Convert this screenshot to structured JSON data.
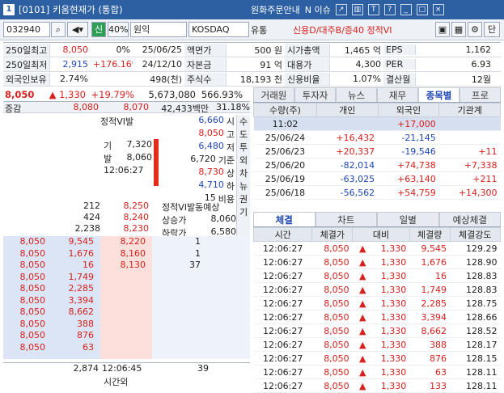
{
  "title": {
    "number": "1",
    "name": "[0101] 키움현재가 (통합)",
    "btn_order_guide": "원화주문안내",
    "btn_issue": "N 이슈"
  },
  "toolbar": {
    "code": "032940",
    "qty": "40%",
    "name": "원익",
    "market": "KOSDAQ",
    "sector": "유통",
    "status": "신용D/대주B/증40 정적VI",
    "btn_new": "신",
    "btn_search": "단"
  },
  "info": {
    "r1": [
      "250일최고",
      "8,050",
      "0%",
      "25/06/25",
      "액면가",
      "500 원",
      "시가총액",
      "1,465 억",
      "EPS",
      "1,162"
    ],
    "r2": [
      "250일최저",
      "2,915",
      "+176.16%",
      "24/12/10",
      "자본금",
      "91 억",
      "대용가",
      "4,300",
      "PER",
      "6.93"
    ],
    "r3": [
      "외국인보유",
      "2.74%",
      "498(천)",
      "주식수",
      "18,193 천",
      "신용비율",
      "1.07%",
      "결산월",
      "12월"
    ]
  },
  "price": {
    "cur": "8,050",
    "change": "▲ 1,330",
    "rate": "+19.79%",
    "volume": "5,673,080",
    "vol_rate": "566.93%"
  },
  "orderbook": {
    "head": [
      "증감",
      "8,080",
      "8,070",
      "42,433백만",
      "31.18%"
    ],
    "vi_label": "정적VI발",
    "summary": [
      [
        "기",
        "7,320"
      ],
      [
        "발",
        "8,060"
      ],
      [
        "12:06:27",
        ""
      ]
    ],
    "sidestat": [
      [
        "6,660",
        "시"
      ],
      [
        "8,050",
        "고"
      ],
      [
        "6,480",
        "저"
      ],
      [
        "6,720",
        "기준"
      ],
      [
        "8,730",
        "상"
      ],
      [
        "4,710",
        "하"
      ],
      [
        "15",
        "비용"
      ]
    ],
    "side_tabs": [
      "수",
      "도",
      "투",
      "외",
      "차",
      "뉴",
      "권",
      "기"
    ],
    "ask": [
      [
        "212",
        "8,250"
      ],
      [
        "424",
        "8,240"
      ],
      [
        "2,238",
        "8,230"
      ]
    ],
    "expect": {
      "label": "정적VI발동예상",
      "up_label": "상승가",
      "up": "8,060",
      "down_label": "하락가",
      "down": "6,580"
    },
    "bid": [
      [
        "8,050",
        "9,545",
        "8,220",
        "1"
      ],
      [
        "8,050",
        "1,676",
        "8,160",
        "1"
      ],
      [
        "8,050",
        "16",
        "8,130",
        "37"
      ],
      [
        "8,050",
        "1,749",
        "",
        ""
      ],
      [
        "8,050",
        "2,285",
        "",
        ""
      ],
      [
        "8,050",
        "3,394",
        "",
        ""
      ],
      [
        "8,050",
        "8,662",
        "",
        ""
      ],
      [
        "8,050",
        "388",
        "",
        ""
      ],
      [
        "8,050",
        "876",
        "",
        ""
      ],
      [
        "8,050",
        "63",
        "",
        ""
      ]
    ],
    "footer": [
      "2,874",
      "12:06:45",
      "39"
    ],
    "after": "시간외"
  },
  "right": {
    "tabs1": [
      "거래원",
      "투자자",
      "뉴스",
      "재무",
      "종목별",
      "프로"
    ],
    "inv_head": [
      "수량(주)",
      "개인",
      "외국인",
      "기관계"
    ],
    "inv_rows": [
      [
        "11:02",
        "",
        "+17,000",
        ""
      ],
      [
        "25/06/24",
        "+16,432",
        "-21,145",
        ""
      ],
      [
        "25/06/23",
        "+20,337",
        "-19,546",
        "+11"
      ],
      [
        "25/06/20",
        "-82,014",
        "+74,738",
        "+7,338"
      ],
      [
        "25/06/19",
        "-63,025",
        "+63,140",
        "+211"
      ],
      [
        "25/06/18",
        "-56,562",
        "+54,759",
        "+14,300"
      ]
    ],
    "tabs2": [
      "체결",
      "차트",
      "일별",
      "예상체결"
    ],
    "trade_head": [
      "시간",
      "체결가",
      "대비",
      "체결량",
      "체결강도"
    ],
    "trade_rows": [
      [
        "12:06:27",
        "8,050",
        "▲",
        "1,330",
        "9,545",
        "129.29"
      ],
      [
        "12:06:27",
        "8,050",
        "▲",
        "1,330",
        "1,676",
        "128.90"
      ],
      [
        "12:06:27",
        "8,050",
        "▲",
        "1,330",
        "16",
        "128.83"
      ],
      [
        "12:06:27",
        "8,050",
        "▲",
        "1,330",
        "1,749",
        "128.83"
      ],
      [
        "12:06:27",
        "8,050",
        "▲",
        "1,330",
        "2,285",
        "128.75"
      ],
      [
        "12:06:27",
        "8,050",
        "▲",
        "1,330",
        "3,394",
        "128.66"
      ],
      [
        "12:06:27",
        "8,050",
        "▲",
        "1,330",
        "8,662",
        "128.52"
      ],
      [
        "12:06:27",
        "8,050",
        "▲",
        "1,330",
        "388",
        "128.17"
      ],
      [
        "12:06:27",
        "8,050",
        "▲",
        "1,330",
        "876",
        "128.15"
      ],
      [
        "12:06:27",
        "8,050",
        "▲",
        "1,330",
        "63",
        "128.11"
      ],
      [
        "12:06:27",
        "8,050",
        "▲",
        "1,330",
        "133",
        "128.11"
      ]
    ]
  }
}
